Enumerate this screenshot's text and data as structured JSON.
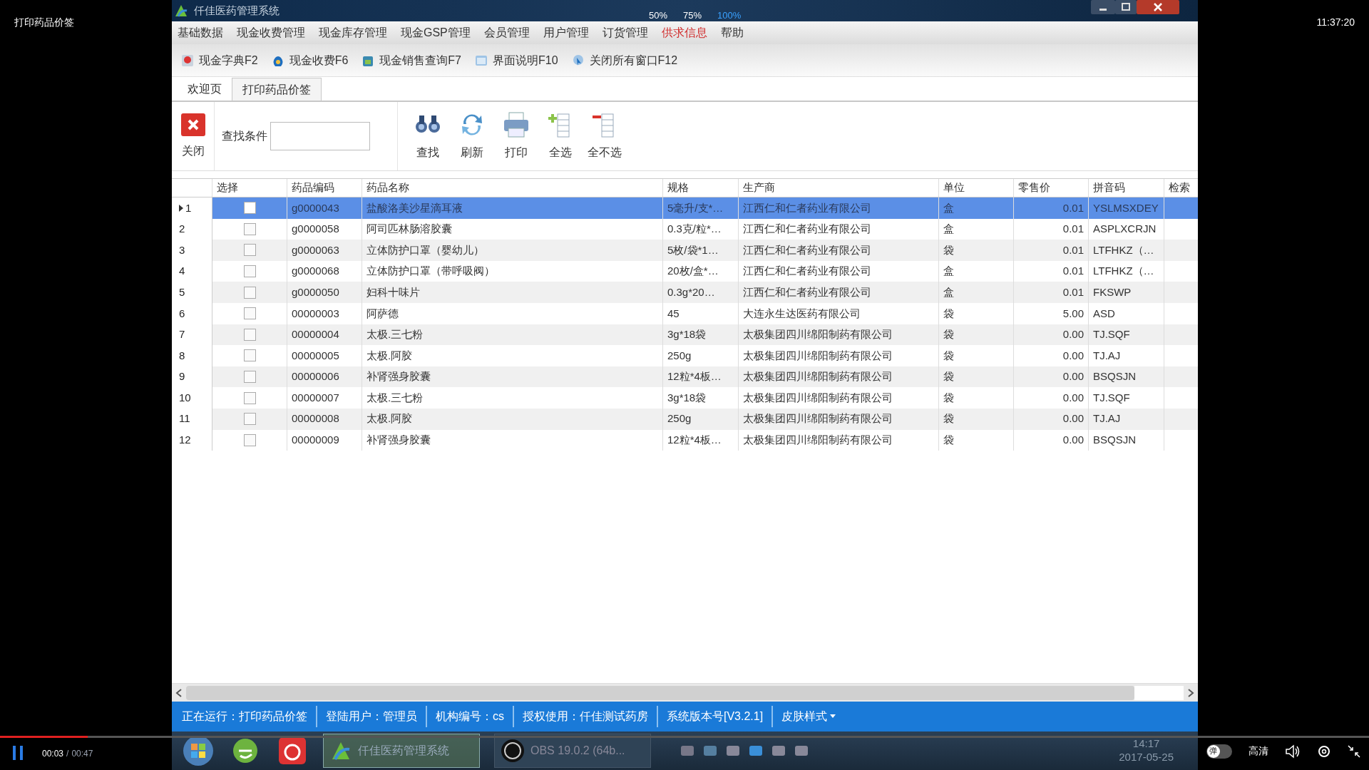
{
  "player": {
    "title": "打印药品价签",
    "clock": "11:37:20",
    "zoom_options": [
      {
        "label": "50%",
        "selected": false
      },
      {
        "label": "75%",
        "selected": false
      },
      {
        "label": "100%",
        "selected": true
      }
    ],
    "time": "00:03",
    "time_separator": "/",
    "duration": "00:47",
    "progress": {
      "level": 0.064
    },
    "danmaku": {
      "label": "弹",
      "on": false
    },
    "quality": "高清"
  },
  "window": {
    "title": "仟佳医药管理系统"
  },
  "menu": [
    {
      "label": "基础数据",
      "highlighted": false
    },
    {
      "label": "现金收费管理",
      "highlighted": false
    },
    {
      "label": "现金库存管理",
      "highlighted": false
    },
    {
      "label": "现金GSP管理",
      "highlighted": false
    },
    {
      "label": "会员管理",
      "highlighted": false
    },
    {
      "label": "用户管理",
      "highlighted": false
    },
    {
      "label": "订货管理",
      "highlighted": false
    },
    {
      "label": "供求信息",
      "highlighted": true
    },
    {
      "label": "帮助",
      "highlighted": false
    }
  ],
  "shortcuts": [
    "现金字典F2",
    "现金收费F6",
    "现金销售查询F7",
    "界面说明F10",
    "关闭所有窗口F12"
  ],
  "tabs": [
    {
      "label": "欢迎页",
      "selected": false
    },
    {
      "label": "打印药品价签",
      "selected": true
    }
  ],
  "ribbon": {
    "close": "关闭",
    "search_label": "查找条件",
    "buttons": [
      "查找",
      "刷新",
      "打印",
      "全选",
      "全不选"
    ]
  },
  "table": {
    "checkbox_column": "选择",
    "columns": [
      "药品编码",
      "药品名称",
      "规格",
      "生产商",
      "单位",
      "零售价",
      "拼音码",
      "检索"
    ],
    "rows": [
      {
        "number": "1",
        "selected": true,
        "checked": false,
        "cells": [
          "g0000043",
          "盐酸洛美沙星滴耳液",
          "5毫升/支*…",
          "江西仁和仁者药业有限公司",
          "盒",
          "0.01",
          "YSLMSXDEY"
        ]
      },
      {
        "number": "2",
        "selected": false,
        "checked": false,
        "cells": [
          "g0000058",
          "阿司匹林肠溶胶囊",
          "0.3克/粒*…",
          "江西仁和仁者药业有限公司",
          "盒",
          "0.01",
          "ASPLXCRJN"
        ]
      },
      {
        "number": "3",
        "selected": false,
        "checked": false,
        "cells": [
          "g0000063",
          "立体防护口罩（婴幼儿）",
          "5枚/袋*1…",
          "江西仁和仁者药业有限公司",
          "袋",
          "0.01",
          "LTFHKZ（…"
        ]
      },
      {
        "number": "4",
        "selected": false,
        "checked": false,
        "cells": [
          "g0000068",
          "立体防护口罩（带呼吸阀）",
          "20枚/盒*…",
          "江西仁和仁者药业有限公司",
          "盒",
          "0.01",
          "LTFHKZ（…"
        ]
      },
      {
        "number": "5",
        "selected": false,
        "checked": false,
        "cells": [
          "g0000050",
          "妇科十味片",
          "0.3g*20…",
          "江西仁和仁者药业有限公司",
          "盒",
          "0.01",
          "FKSWP"
        ]
      },
      {
        "number": "6",
        "selected": false,
        "checked": false,
        "cells": [
          "00000003",
          "阿萨德",
          "45",
          "大连永生达医药有限公司",
          "袋",
          "5.00",
          "ASD"
        ]
      },
      {
        "number": "7",
        "selected": false,
        "checked": false,
        "cells": [
          "00000004",
          "太极.三七粉",
          "3g*18袋",
          "太极集团四川绵阳制药有限公司",
          "袋",
          "0.00",
          "TJ.SQF"
        ]
      },
      {
        "number": "8",
        "selected": false,
        "checked": false,
        "cells": [
          "00000005",
          "太极.阿胶",
          "250g",
          "太极集团四川绵阳制药有限公司",
          "袋",
          "0.00",
          "TJ.AJ"
        ]
      },
      {
        "number": "9",
        "selected": false,
        "checked": false,
        "cells": [
          "00000006",
          "补肾强身胶囊",
          "12粒*4板…",
          "太极集团四川绵阳制药有限公司",
          "袋",
          "0.00",
          "BSQSJN"
        ]
      },
      {
        "number": "10",
        "selected": false,
        "checked": false,
        "cells": [
          "00000007",
          "太极.三七粉",
          "3g*18袋",
          "太极集团四川绵阳制药有限公司",
          "袋",
          "0.00",
          "TJ.SQF"
        ]
      },
      {
        "number": "11",
        "selected": false,
        "checked": false,
        "cells": [
          "00000008",
          "太极.阿胶",
          "250g",
          "太极集团四川绵阳制药有限公司",
          "袋",
          "0.00",
          "TJ.AJ"
        ]
      },
      {
        "number": "12",
        "selected": false,
        "checked": false,
        "cells": [
          "00000009",
          "补肾强身胶囊",
          "12粒*4板…",
          "太极集团四川绵阳制药有限公司",
          "袋",
          "0.00",
          "BSQSJN"
        ]
      }
    ]
  },
  "status_bar": [
    "正在运行：打印药品价签",
    "登陆用户：管理员",
    "机构编号：cs",
    "授权使用：仟佳测试药房",
    "系统版本号[V3.2.1]",
    "皮肤样式"
  ],
  "taskbar": {
    "buttons": [
      "仟佳医药管理系统",
      "OBS 19.0.2 (64b..."
    ],
    "time": "14:17",
    "date": "2017-05-25"
  }
}
